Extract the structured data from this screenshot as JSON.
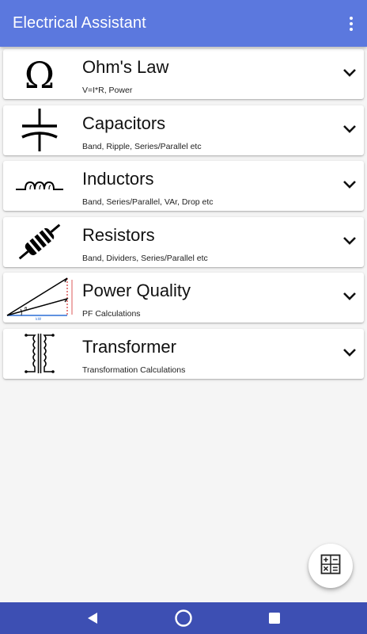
{
  "app": {
    "title": "Electrical Assistant",
    "appbar_color": "#5b78de",
    "navbar_color": "#3d4fb3"
  },
  "toolbar": {
    "overflow_icon": "more-vert-icon"
  },
  "cards": [
    {
      "title": "Ohm's Law",
      "subtitle": "V=I*R, Power",
      "icon": "omega-icon"
    },
    {
      "title": "Capacitors",
      "subtitle": "Band, Ripple, Series/Parallel etc",
      "icon": "capacitor-icon"
    },
    {
      "title": "Inductors",
      "subtitle": "Band, Series/Parallel, VAr, Drop etc",
      "icon": "inductor-icon"
    },
    {
      "title": "Resistors",
      "subtitle": "Band, Dividers, Series/Parallel etc",
      "icon": "resistor-icon"
    },
    {
      "title": "Power Quality",
      "subtitle": "PF Calculations",
      "icon": "power-triangle-icon"
    },
    {
      "title": "Transformer",
      "subtitle": "Transformation Calculations",
      "icon": "transformer-icon"
    }
  ],
  "fab": {
    "icon": "calculator-icon"
  },
  "system_nav": {
    "back": "back-icon",
    "home": "home-icon",
    "recents": "recents-icon"
  }
}
